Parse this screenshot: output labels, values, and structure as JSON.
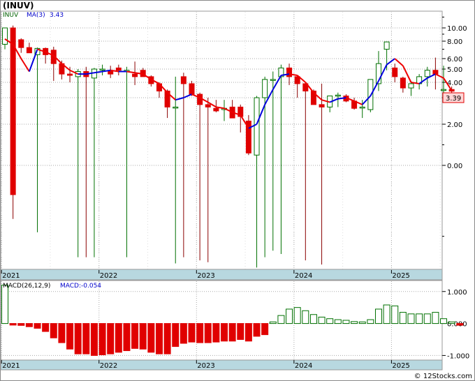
{
  "header": {
    "symbol_title": "(INUV)"
  },
  "price_panel": {
    "symbol": "INUV",
    "ma_label": "MA(3)",
    "ma_value": "3.43",
    "last_price_label": "3.39",
    "y_ticks": [
      "10.00",
      "8.00",
      "6.00",
      "5.00",
      "4.00",
      "3.00",
      "2.00",
      "0.00"
    ]
  },
  "macd_panel": {
    "label": "MACD(26,12,9)",
    "value_label": "MACD:-0.054",
    "y_ticks": [
      "1.000",
      "0.000",
      "-1.000"
    ]
  },
  "x_axis": {
    "year_labels": [
      "2021",
      "2022",
      "2023",
      "2024",
      "2025"
    ]
  },
  "footer": {
    "watermark": "© 12Stocks.com"
  },
  "colors": {
    "up": "#007000",
    "down": "#e00000",
    "ma_up": "#0000dd",
    "ma_down": "#ee0000",
    "axis_band": "#b8d8e0"
  },
  "chart_data": {
    "type": "candlestick",
    "interval": "monthly",
    "x": [
      "2021-01",
      "2021-02",
      "2021-03",
      "2021-04",
      "2021-05",
      "2021-06",
      "2021-07",
      "2021-08",
      "2021-09",
      "2021-10",
      "2021-11",
      "2021-12",
      "2022-01",
      "2022-02",
      "2022-03",
      "2022-04",
      "2022-05",
      "2022-06",
      "2022-07",
      "2022-08",
      "2022-09",
      "2022-10",
      "2022-11",
      "2022-12",
      "2023-01",
      "2023-02",
      "2023-03",
      "2023-04",
      "2023-05",
      "2023-06",
      "2023-07",
      "2023-08",
      "2023-09",
      "2023-10",
      "2023-11",
      "2023-12",
      "2024-01",
      "2024-02",
      "2024-03",
      "2024-04",
      "2024-05",
      "2024-06",
      "2024-07",
      "2024-08",
      "2024-09",
      "2024-10",
      "2024-11",
      "2024-12",
      "2025-01",
      "2025-02",
      "2025-03",
      "2025-04",
      "2025-05",
      "2025-06",
      "2025-07",
      "2025-08",
      "2025-09",
      "2025-10"
    ],
    "open": [
      7.6,
      10.0,
      8.2,
      7.2,
      6.4,
      7.1,
      6.9,
      5.5,
      4.6,
      4.4,
      4.8,
      4.3,
      5.0,
      4.8,
      5.1,
      4.8,
      4.6,
      4.9,
      4.4,
      3.9,
      3.4,
      2.6,
      4.4,
      3.9,
      3.2,
      2.7,
      2.55,
      2.5,
      2.6,
      2.6,
      2.1,
      1.25,
      3.0,
      4.2,
      4.4,
      5.1,
      4.4,
      3.9,
      3.4,
      2.7,
      2.6,
      3.1,
      3.1,
      2.85,
      2.6,
      2.5,
      3.9,
      7.0,
      5.1,
      4.3,
      3.6,
      3.9,
      4.4,
      4.9,
      3.5,
      3.5
    ],
    "high": [
      9.8,
      10.4,
      8.4,
      7.8,
      7.2,
      7.2,
      7.3,
      5.8,
      5.2,
      5.0,
      5.2,
      5.1,
      5.4,
      5.3,
      5.4,
      5.2,
      5.7,
      5.1,
      4.5,
      4.0,
      3.5,
      4.4,
      4.7,
      4.1,
      3.3,
      3.0,
      2.9,
      2.9,
      2.9,
      2.7,
      2.3,
      3.1,
      4.4,
      4.8,
      5.4,
      5.5,
      4.5,
      4.0,
      3.5,
      3.9,
      3.1,
      3.3,
      3.2,
      3.0,
      2.9,
      3.8,
      6.8,
      7.5,
      5.5,
      4.4,
      4.1,
      4.6,
      5.2,
      6.1,
      5.3,
      3.7
    ],
    "low": [
      7.0,
      0.7,
      6.6,
      6.9,
      0.55,
      5.5,
      4.1,
      4.2,
      4.0,
      0.2,
      0.2,
      0.2,
      4.5,
      4.3,
      4.5,
      0.2,
      3.8,
      4.4,
      3.7,
      3.0,
      2.2,
      0.1,
      0.2,
      3.1,
      0.15,
      0.12,
      2.4,
      2.1,
      2.3,
      1.8,
      1.25,
      0.03,
      0.2,
      0.3,
      0.25,
      3.8,
      3.0,
      0.15,
      2.9,
      0.08,
      2.4,
      2.6,
      2.8,
      2.5,
      2.2,
      2.4,
      3.4,
      4.9,
      4.0,
      3.3,
      3.1,
      3.5,
      3.7,
      3.5,
      3.3,
      3.3
    ],
    "close": [
      10.0,
      0.9,
      7.2,
      6.6,
      7.1,
      6.4,
      5.5,
      4.6,
      4.5,
      4.8,
      4.4,
      5.0,
      5.0,
      4.6,
      4.9,
      4.9,
      4.4,
      4.4,
      3.9,
      3.4,
      2.6,
      2.6,
      3.9,
      3.2,
      2.7,
      2.6,
      2.45,
      2.55,
      2.2,
      2.25,
      1.3,
      3.0,
      4.2,
      4.2,
      5.1,
      4.4,
      3.9,
      3.4,
      2.7,
      2.6,
      3.1,
      3.15,
      2.85,
      2.55,
      2.6,
      4.2,
      5.5,
      7.9,
      4.4,
      3.6,
      3.9,
      4.4,
      4.9,
      4.6,
      3.5,
      3.39
    ],
    "ma3": [
      8.3,
      7.6,
      6.0,
      4.8,
      7.0,
      6.7,
      6.3,
      5.5,
      4.9,
      4.6,
      4.6,
      4.7,
      4.8,
      4.9,
      4.8,
      4.8,
      4.7,
      4.6,
      4.2,
      3.9,
      3.3,
      2.9,
      3.0,
      3.2,
      3.0,
      2.8,
      2.6,
      2.55,
      2.4,
      2.3,
      1.9,
      2.0,
      2.7,
      3.5,
      4.5,
      4.6,
      4.5,
      4.0,
      3.3,
      2.9,
      2.8,
      2.95,
      3.0,
      2.85,
      2.7,
      3.1,
      4.1,
      5.4,
      6.0,
      5.3,
      4.0,
      3.9,
      4.3,
      4.6,
      4.3,
      3.43
    ],
    "macd_hist": [
      1.2,
      -0.05,
      -0.06,
      -0.1,
      -0.15,
      -0.25,
      -0.45,
      -0.6,
      -0.8,
      -0.95,
      -0.95,
      -1.0,
      -0.98,
      -0.95,
      -0.9,
      -0.85,
      -0.78,
      -0.8,
      -0.9,
      -0.95,
      -0.95,
      -0.72,
      -0.62,
      -0.58,
      -0.6,
      -0.6,
      -0.58,
      -0.55,
      -0.55,
      -0.5,
      -0.55,
      -0.4,
      -0.35,
      0.05,
      0.25,
      0.45,
      0.5,
      0.4,
      0.28,
      0.2,
      0.15,
      0.12,
      0.1,
      0.06,
      0.05,
      0.12,
      0.45,
      0.58,
      0.55,
      0.35,
      0.3,
      0.3,
      0.3,
      0.35,
      0.15,
      0.05,
      -0.054
    ],
    "y_scale": "log",
    "price_ylim": [
      0.01,
      12
    ],
    "macd_ylim": [
      -1.1,
      1.3
    ]
  }
}
